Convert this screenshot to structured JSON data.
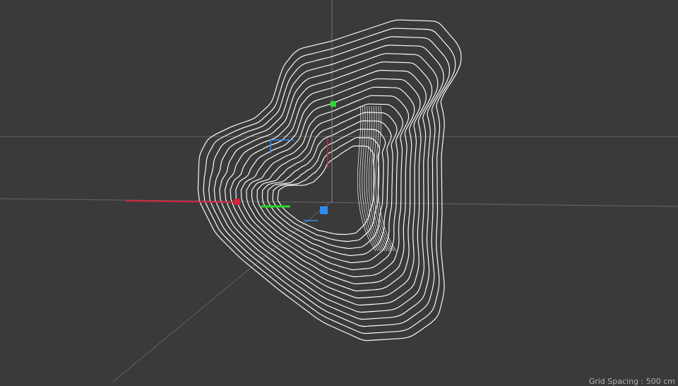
{
  "viewport": {
    "background_color": "#3a3a3a",
    "grid_color": "#5b5b5b",
    "wireframe_color": "#ffffff",
    "axis_colors": {
      "x": "#d3233d",
      "y": "#2bd82b",
      "z": "#2f8df0"
    },
    "handles": [
      {
        "name": "x-axis-handle",
        "color": "#d3233d"
      },
      {
        "name": "y-axis-handle",
        "color": "#2bd82b"
      },
      {
        "name": "z-axis-handle",
        "color": "#2f8df0"
      }
    ],
    "wireframe_ring_count": 16
  },
  "hud": {
    "bottom_right_text": "Grid Spacing : 500 cm"
  }
}
